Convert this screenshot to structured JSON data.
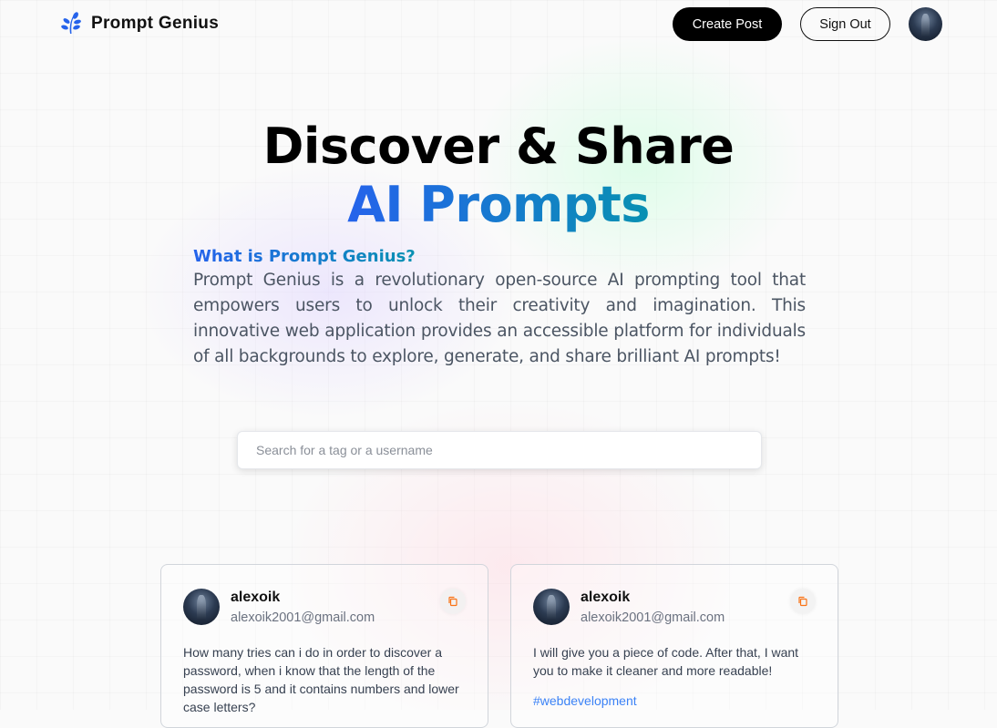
{
  "nav": {
    "brand": "Prompt Genius",
    "create_post": "Create Post",
    "sign_out": "Sign Out"
  },
  "hero": {
    "line1": "Discover & Share",
    "line2": "AI Prompts",
    "about_title": "What is Prompt Genius?",
    "about_text": "Prompt Genius is a revolutionary open-source AI prompting tool that empowers users to unlock their creativity and imagination. This innovative web application provides an accessible platform for individuals of all backgrounds to explore, generate, and share brilliant AI prompts!"
  },
  "search": {
    "placeholder": "Search for a tag or a username",
    "value": ""
  },
  "posts": [
    {
      "username": "alexoik",
      "email": "alexoik2001@gmail.com",
      "prompt": "How many tries can i do in order to discover a password, when i know that the length of the password is 5 and it contains numbers and lower case letters?",
      "tag": ""
    },
    {
      "username": "alexoik",
      "email": "alexoik2001@gmail.com",
      "prompt": "I will give you a piece of code. After that, I want you to make it cleaner and more readable!",
      "tag": "#webdevelopment"
    }
  ],
  "colors": {
    "accent_start": "#2563eb",
    "accent_end": "#0891b2",
    "tag": "#3b82f6",
    "copy_icon": "#f97316"
  },
  "icons": [
    "logo-icon",
    "copy-icon",
    "avatar"
  ]
}
